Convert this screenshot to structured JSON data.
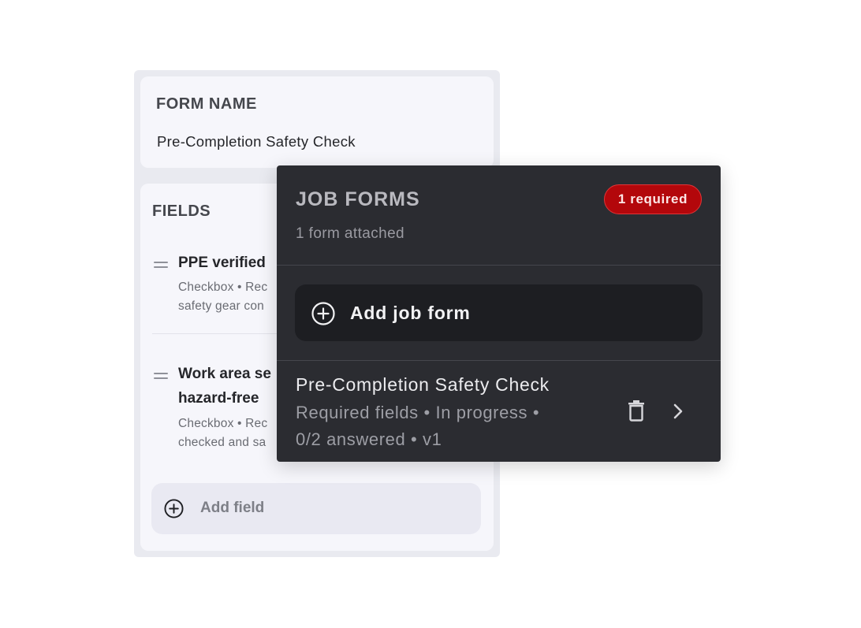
{
  "form_editor": {
    "form_name_label": "FORM NAME",
    "form_name_value": "Pre-Completion Safety Check",
    "fields_label": "FIELDS",
    "fields": [
      {
        "title": "PPE verified",
        "desc_line1": "Checkbox • Rec",
        "desc_line2": "safety gear con"
      },
      {
        "title": "Work area se",
        "title_line2": "hazard-free",
        "desc_line1": "Checkbox • Rec",
        "desc_line2": "checked and sa"
      }
    ],
    "add_field_label": "Add field"
  },
  "job_forms": {
    "title": "JOB FORMS",
    "subtitle": "1 form attached",
    "badge": "1 required",
    "add_label": "Add job form",
    "item": {
      "title": "Pre-Completion Safety Check",
      "meta_line1": "Required fields • In progress •",
      "meta_line2": "0/2 answered • v1"
    }
  },
  "colors": {
    "badge_bg": "#b3070b",
    "panel_dark": "#2b2c31",
    "panel_light": "#f6f6fb"
  },
  "icons": [
    "drag-handle-icon",
    "plus-circle-icon",
    "trash-icon",
    "chevron-right-icon"
  ]
}
